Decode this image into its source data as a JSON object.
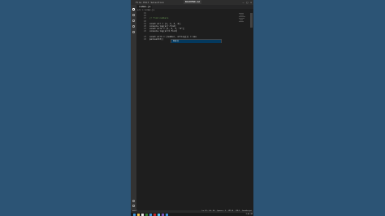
{
  "titlebar": {
    "menu": [
      "File",
      "Edit",
      "Selection",
      "View",
      "Go",
      "Run"
    ],
    "title": "BACKEND.md",
    "controls": [
      "–",
      "□",
      "×"
    ]
  },
  "tabs": [
    {
      "label": "index.js"
    }
  ],
  "breadcrumb": "src > index.js",
  "editor": {
    "lines": [
      {
        "num": "15",
        "text": ""
      },
      {
        "num": "16",
        "text": ""
      },
      {
        "num": "17",
        "text": "// find numbers",
        "comment": true
      },
      {
        "num": "18",
        "text": ""
      },
      {
        "num": "19",
        "text": "const arr = [1, 2, 3, 4];"
      },
      {
        "num": "20",
        "text": "console.log(arr.find("
      },
      {
        "num": "21",
        "text": "const arr2 = [1, 2, 3, \"4\"];"
      },
      {
        "num": "22",
        "text": "console.log(arr2.find("
      }
    ],
    "suggestion": "map()",
    "after_lines": [
      {
        "num": "23",
        "text": "const arr3 = [number, string[]] = new"
      },
      {
        "num": "24",
        "text": "pareseInt()"
      }
    ]
  },
  "statusbar": {
    "left": "main*",
    "right": [
      "Ln 22, Col 24",
      "Spaces: 2",
      "UTF-8",
      "CRLF",
      "JavaScript"
    ]
  },
  "taskbar": {
    "clock": "2:45 PM",
    "icon_colors": [
      "#3a96dd",
      "#f2c14e",
      "#e8e8e8",
      "#2e7d32",
      "#3a96dd",
      "#c62828",
      "#4fc3f7",
      "#7e57c2",
      "#3a96dd"
    ]
  }
}
